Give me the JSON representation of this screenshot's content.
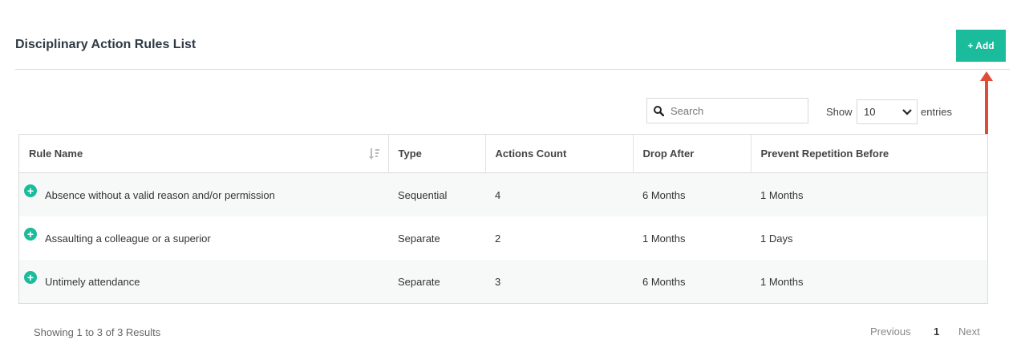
{
  "page_title": "Disciplinary Action Rules List",
  "add_button": "+ Add",
  "search": {
    "placeholder": "Search"
  },
  "show_label": "Show",
  "entries_value": "10",
  "entries_label": "entries",
  "columns": [
    "Rule Name",
    "Type",
    "Actions Count",
    "Drop After",
    "Prevent Repetition Before"
  ],
  "rows": [
    {
      "rule_name": "Absence without a valid reason and/or permission",
      "type": "Sequential",
      "actions_count": "4",
      "drop_after": "6 Months",
      "prevent_repetition": "1 Months"
    },
    {
      "rule_name": "Assaulting a colleague or a superior",
      "type": "Separate",
      "actions_count": "2",
      "drop_after": "1 Months",
      "prevent_repetition": "1 Days"
    },
    {
      "rule_name": "Untimely attendance",
      "type": "Separate",
      "actions_count": "3",
      "drop_after": "6 Months",
      "prevent_repetition": "1 Months"
    }
  ],
  "footer": {
    "showing": "Showing 1 to 3 of 3 Results",
    "previous": "Previous",
    "page": "1",
    "next": "Next"
  },
  "colors": {
    "accent": "#1bbc9b",
    "arrow": "#e04b35"
  }
}
